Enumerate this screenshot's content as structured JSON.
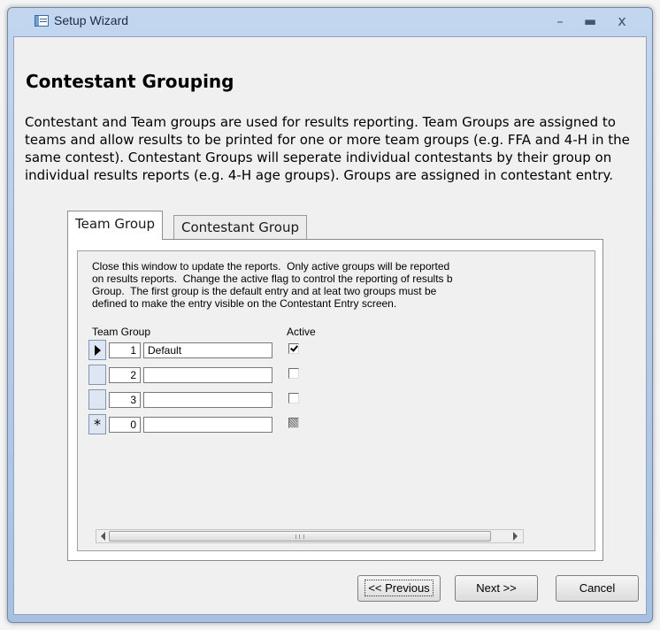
{
  "window": {
    "title": "Setup Wizard",
    "controls": {
      "minimize": "–",
      "maximize": "▬",
      "close": "x"
    }
  },
  "page": {
    "heading": "Contestant Grouping",
    "intro": "Contestant and Team groups are used for results reporting.  Team Groups are assigned to teams and allow results to be printed for one or more team groups (e.g. FFA and 4-H in the same contest).  Contestant Groups will seperate individual contestants by their group on individual results reports (e.g. 4-H age groups). Groups are assigned in contestant entry."
  },
  "tabs": [
    {
      "label": "Team Group",
      "selected": true
    },
    {
      "label": "Contestant Group",
      "selected": false
    }
  ],
  "subform": {
    "instructions": "Close this window to update the reports.  Only active groups will be reported\non results reports.  Change the active flag to control the reporting of results b\nGroup.  The first group is the default entry and at leat two groups must be\ndefined to make the entry visible on the Contestant Entry screen.",
    "columns": {
      "team_group": "Team Group",
      "active": "Active"
    },
    "rows": [
      {
        "number": "1",
        "name": "Default",
        "active": true,
        "selector": "current"
      },
      {
        "number": "2",
        "name": "",
        "active": false,
        "selector": ""
      },
      {
        "number": "3",
        "name": "",
        "active": false,
        "selector": ""
      },
      {
        "number": "0",
        "name": "",
        "active": null,
        "selector": "*"
      }
    ]
  },
  "buttons": {
    "previous": "<< Previous",
    "next": "Next >>",
    "cancel": "Cancel"
  }
}
